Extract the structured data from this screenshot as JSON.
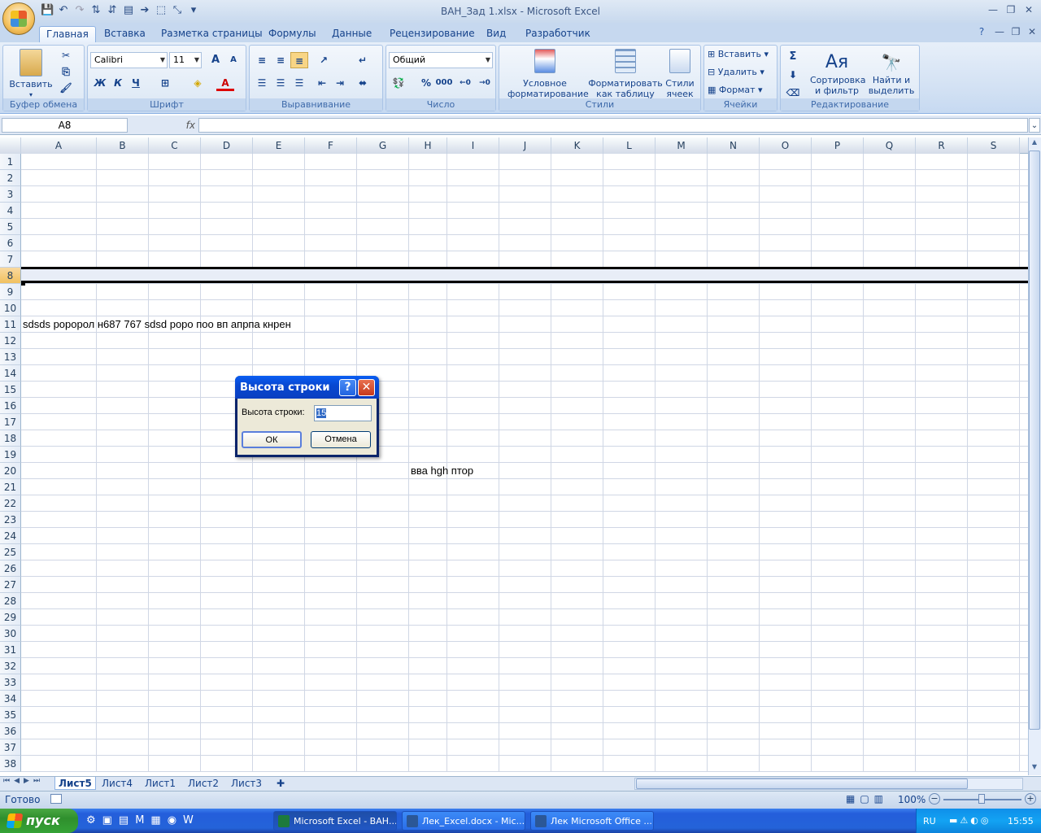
{
  "window": {
    "title": "ВАН_Зад 1.xlsx - Microsoft Excel"
  },
  "tabs": [
    "Главная",
    "Вставка",
    "Разметка страницы",
    "Формулы",
    "Данные",
    "Рецензирование",
    "Вид",
    "Разработчик"
  ],
  "ribbon": {
    "clipboard": {
      "paste": "Вставить",
      "label": "Буфер обмена"
    },
    "font": {
      "name": "Calibri",
      "size": "11",
      "label": "Шрифт",
      "bold": "Ж",
      "italic": "К",
      "underline": "Ч"
    },
    "alignment": {
      "label": "Выравнивание"
    },
    "number": {
      "format": "Общий",
      "label": "Число",
      "percent": "%",
      "thousands": "000"
    },
    "styles": {
      "conditional": "Условное форматирование",
      "table": "Форматировать как таблицу",
      "cell_styles": "Стили ячеек",
      "label": "Стили"
    },
    "cells": {
      "insert": "Вставить",
      "delete": "Удалить",
      "format": "Формат",
      "label": "Ячейки"
    },
    "editing": {
      "sort": "Сортировка и фильтр",
      "find": "Найти и выделить",
      "label": "Редактирование",
      "sum": "Σ"
    }
  },
  "formula_bar": {
    "name_box": "A8",
    "fx": "fx",
    "value": ""
  },
  "columns": [
    "A",
    "B",
    "C",
    "D",
    "E",
    "F",
    "G",
    "H",
    "I",
    "J",
    "K",
    "L",
    "M",
    "N",
    "O",
    "P",
    "Q",
    "R",
    "S"
  ],
  "rows": [
    "1",
    "2",
    "3",
    "4",
    "5",
    "6",
    "7",
    "8",
    "9",
    "10",
    "11",
    "12",
    "13",
    "14",
    "15",
    "16",
    "17",
    "18",
    "19",
    "20",
    "21",
    "22",
    "23",
    "24",
    "25",
    "26",
    "27",
    "28",
    "29",
    "30",
    "31",
    "32",
    "33",
    "34",
    "35",
    "36",
    "37",
    "38"
  ],
  "cells": {
    "row11": "sdsds роророл н687 767  sdsd роро поо вп апрпа кнрен",
    "row20": "вва hgh птор"
  },
  "sheets": [
    "Лист5",
    "Лист4",
    "Лист1",
    "Лист2",
    "Лист3"
  ],
  "status": {
    "ready": "Готово",
    "zoom": "100%"
  },
  "dialog": {
    "title": "Высота строки",
    "field_label": "Высота строки:",
    "field_value": "15",
    "ok": "ОК",
    "cancel": "Отмена",
    "help": "?",
    "close": "✕"
  },
  "taskbar": {
    "start": "пуск",
    "tasks": [
      "Microsoft Excel - ВАН...",
      "Лек_Excel.docx - Mic...",
      "Лек Microsoft Office ..."
    ],
    "lang": "RU",
    "clock": "15:55"
  },
  "colors": {
    "accent": "#15428b",
    "selection": "#f1c15f"
  }
}
